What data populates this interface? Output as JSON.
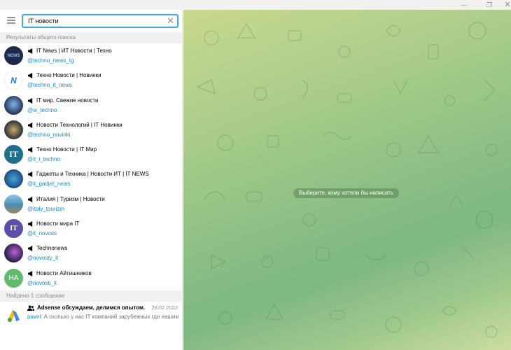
{
  "search": {
    "value": "IT новости"
  },
  "sections": {
    "global_search": "Результаты общего поиска",
    "messages_found": "Найдено 1 сообщение"
  },
  "results": [
    {
      "title": "IT News | ИТ Новости | Техно",
      "handle": "@techno_news_tg",
      "avatar_color": "#1c2a4a"
    },
    {
      "title": "Техно Новости | Новинки",
      "handle": "@techno_it_news",
      "avatar_color": "#ffffff"
    },
    {
      "title": "IT мир. Свежие новости",
      "handle": "@w_techno",
      "avatar_color": "#23335c"
    },
    {
      "title": "Новости Технологий | IT Новинки",
      "handle": "@techno_novinki",
      "avatar_color": "#3a3a38"
    },
    {
      "title": "Техно Новости | IT Мир",
      "handle": "@it_i_techno",
      "avatar_color": "#1f6f8b"
    },
    {
      "title": "Гаджеты и Техника | Новости ИТ | IT NEWS",
      "handle": "@it_gadjet_news",
      "avatar_color": "#1e4f82"
    },
    {
      "title": "Италия | Туризм | Новости",
      "handle": "@italy_tourizm",
      "avatar_color": "#4b8db0"
    },
    {
      "title": "Новости мира IT",
      "handle": "@it_novosti",
      "avatar_color": "#5b4fa8"
    },
    {
      "title": "Technonews",
      "handle": "@novosty_it",
      "avatar_color": "#2a2250"
    },
    {
      "title": "Новости Айтишников",
      "handle": "@novosti_it",
      "avatar_color": "#62bb6a",
      "initials": "НА"
    }
  ],
  "message": {
    "title": "Adsense обсуждаем, делимся опытом.",
    "date": "26.02.2022",
    "sender": "pavel:",
    "text": " А сколько у нас IT компаний зарубежных где нашим ..."
  },
  "chat": {
    "empty_hint": "Выберите, кому хотели бы написать"
  },
  "colors": {
    "accent": "#40a7e3",
    "link": "#168acd",
    "section_bg": "#f1f1f1"
  },
  "icons": [
    "minimize-icon",
    "maximize-icon",
    "close-icon",
    "menu-icon",
    "clear-icon",
    "megaphone-icon",
    "group-icon",
    "adsense-logo"
  ]
}
